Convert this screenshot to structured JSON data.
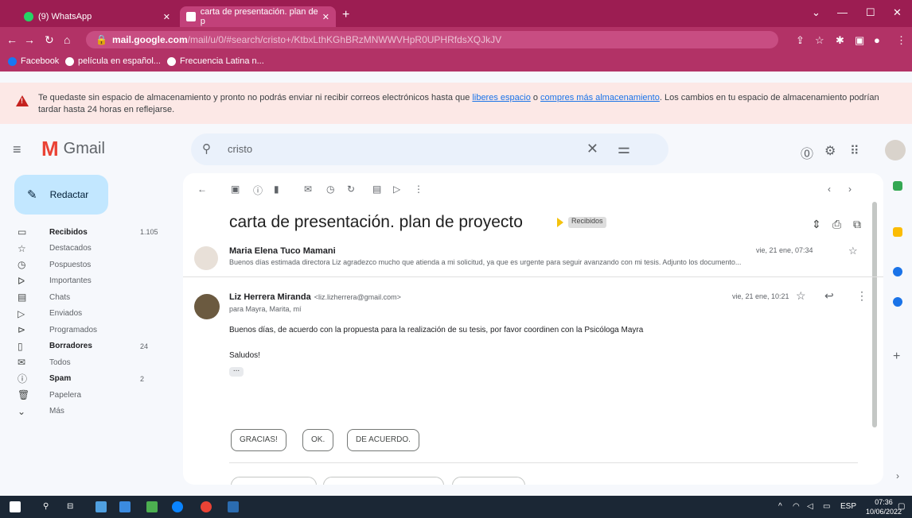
{
  "browser": {
    "tabs": [
      {
        "label": "(9) WhatsApp",
        "icon": "whatsapp-icon"
      },
      {
        "label": "carta de presentación. plan de p",
        "icon": "gmail-icon"
      }
    ],
    "url_host": "mail.google.com",
    "url_path": "/mail/u/0/#search/cristo+/KtbxLthKGhBRzMNWWVHpR0UPHRfdsXQJkJV",
    "bookmarks": [
      "Facebook",
      "película en español...",
      "Frecuencia Latina n..."
    ]
  },
  "banner": {
    "text_before": "Te quedaste sin espacio de almacenamiento y pronto no podrás enviar ni recibir correos electrónicos hasta que ",
    "link1": "liberes espacio",
    "text_mid": " o ",
    "link2": "compres más almacenamiento",
    "text_after": ". Los cambios en tu espacio de almacenamiento podrían tardar hasta 24 horas en reflejarse."
  },
  "header": {
    "app_name": "Gmail",
    "search_value": "cristo"
  },
  "sidebar": {
    "compose_label": "Redactar",
    "items": [
      {
        "label": "Recibidos",
        "count": "1.105",
        "bold": true
      },
      {
        "label": "Destacados",
        "count": ""
      },
      {
        "label": "Pospuestos",
        "count": ""
      },
      {
        "label": "Importantes",
        "count": ""
      },
      {
        "label": "Chats",
        "count": ""
      },
      {
        "label": "Enviados",
        "count": ""
      },
      {
        "label": "Programados",
        "count": ""
      },
      {
        "label": "Borradores",
        "count": "24",
        "bold": true
      },
      {
        "label": "Todos",
        "count": ""
      },
      {
        "label": "Spam",
        "count": "2",
        "bold": true
      },
      {
        "label": "Papelera",
        "count": ""
      },
      {
        "label": "Más",
        "count": ""
      }
    ]
  },
  "thread": {
    "subject": "carta de presentación. plan de proyecto",
    "label": "Recibidos",
    "messages": [
      {
        "sender": "Maria Elena Tuco Mamani",
        "date": "vie, 21 ene, 07:34",
        "snippet": "Buenos días estimada directora Liz agradezco mucho que atienda a mi solicitud, ya que es urgente para seguir avanzando con mi tesis. Adjunto los documento..."
      },
      {
        "sender": "Liz Herrera Miranda",
        "email": "<liz.lizherrera@gmail.com>",
        "to": "para Mayra, Marita, mí",
        "date": "vie, 21 ene, 10:21",
        "body": "Buenos días, de acuerdo con la propuesta para la realización de su tesis, por favor coordinen con la Psicóloga Mayra",
        "signoff": "Saludos!"
      }
    ],
    "smart_replies": [
      "GRACIAS!",
      "OK.",
      "DE ACUERDO."
    ]
  },
  "taskbar": {
    "time": "07:36",
    "date": "10/06/2022",
    "lang": "ESP"
  }
}
